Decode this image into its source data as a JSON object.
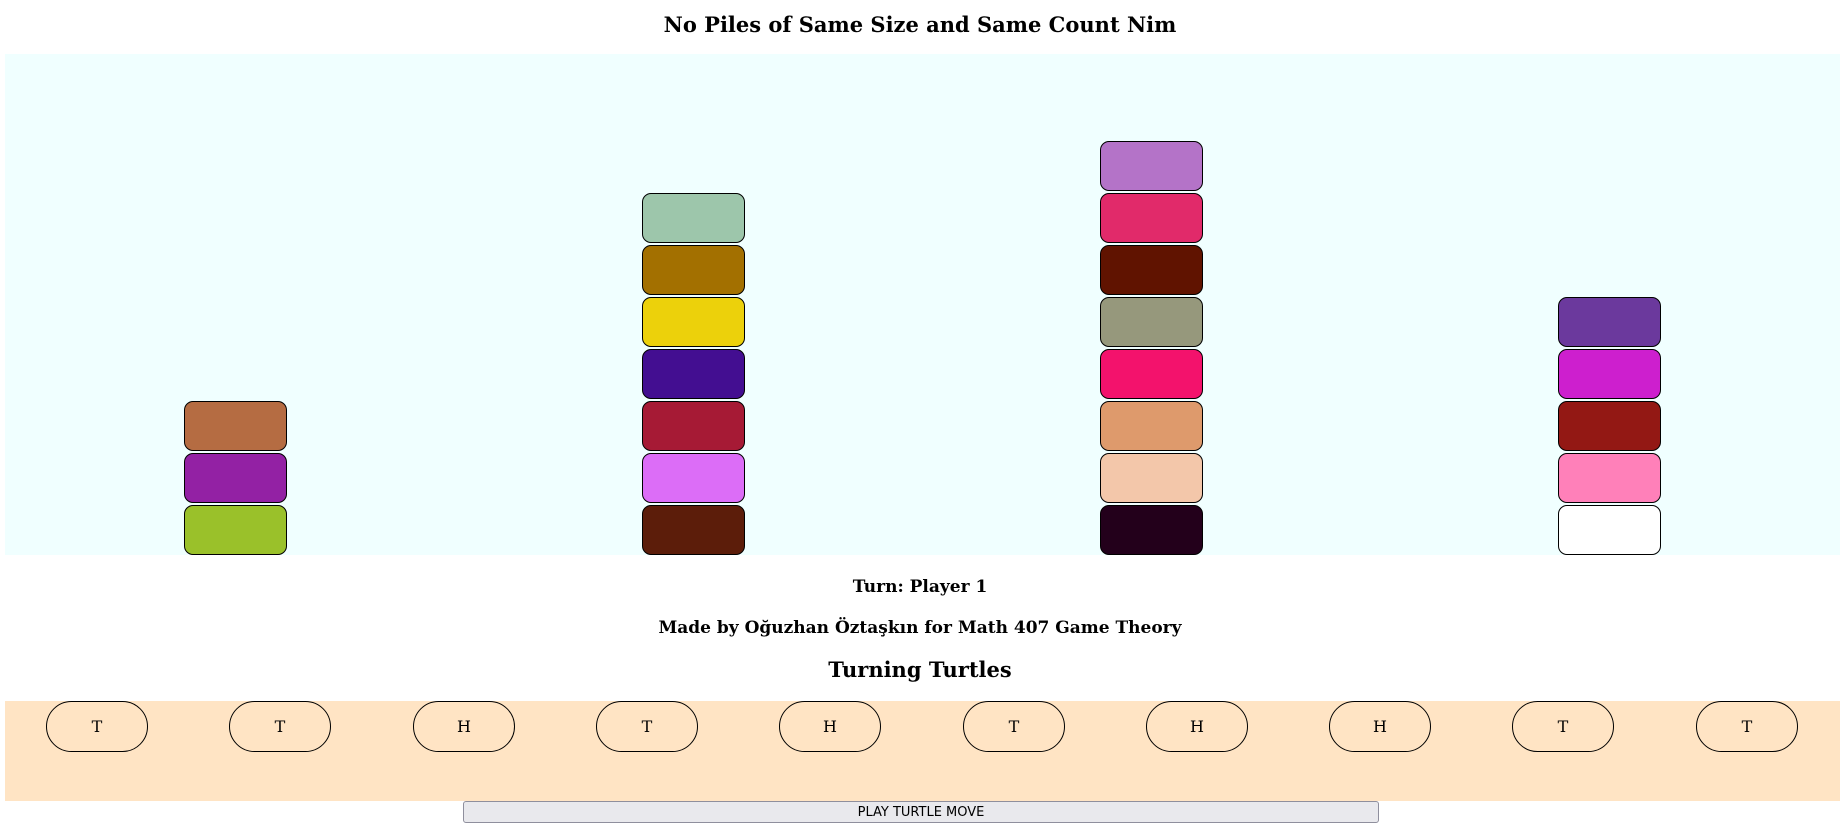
{
  "title": "No Piles of Same Size and Same Count Nim",
  "nim": {
    "piles": [
      {
        "blocks": [
          "#b56c42",
          "#9321a4",
          "#9ac12a"
        ]
      },
      {
        "blocks": [
          "#9dc6ab",
          "#a37000",
          "#ecd10b",
          "#430e91",
          "#a61a35",
          "#dc6df7",
          "#5c1d0a"
        ]
      },
      {
        "blocks": [
          "#b473c8",
          "#e12a6a",
          "#601300",
          "#96987c",
          "#f3126c",
          "#de9a6c",
          "#f3c7aa",
          "#23001b"
        ]
      },
      {
        "blocks": [
          "#6b399d",
          "#cd1fce",
          "#931814",
          "#ff80b9",
          "#ffffff"
        ]
      }
    ]
  },
  "status": {
    "turn": "Turn: Player 1"
  },
  "credit": "Made by Oğuzhan Öztaşkın for Math 407 Game Theory",
  "turtles": {
    "title": "Turning Turtles",
    "values": [
      "T",
      "T",
      "H",
      "T",
      "H",
      "T",
      "H",
      "H",
      "T",
      "T"
    ],
    "play_button": "PLAY TURTLE MOVE"
  }
}
